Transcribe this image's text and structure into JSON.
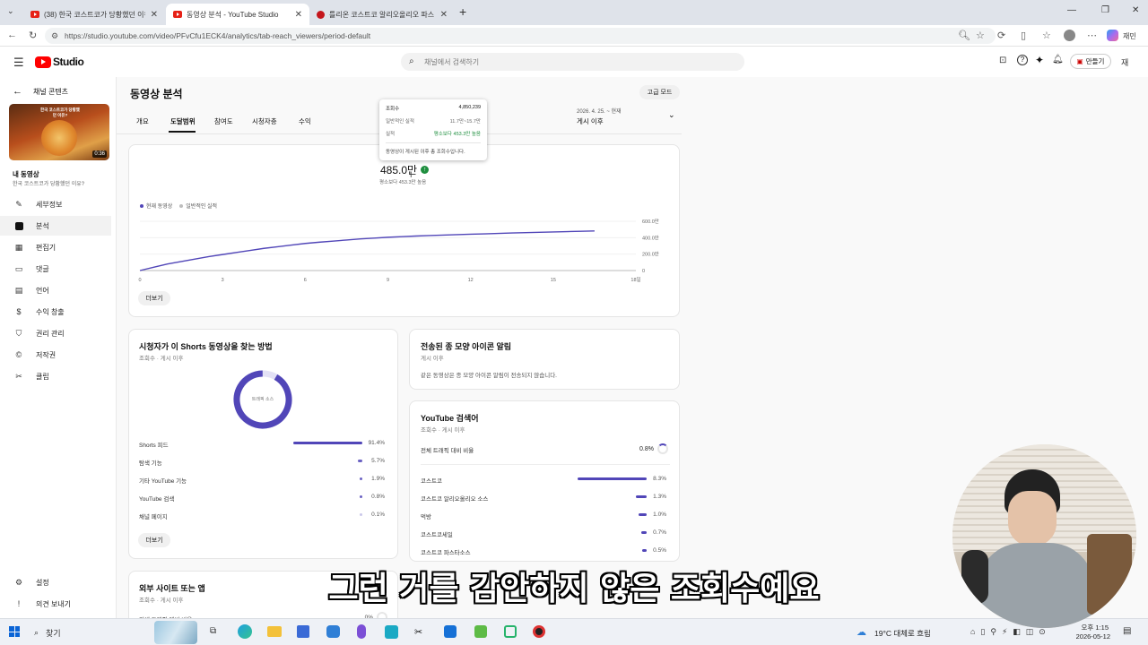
{
  "browser": {
    "tabs": [
      {
        "label": "(38) 한국 코스트코가 당황했던 이유"
      },
      {
        "label": "동영상 분석 - YouTube Studio"
      },
      {
        "label": "틀리온 코스트코 알리오올리오 파스"
      }
    ],
    "url": "https://studio.youtube.com/video/PFvCfu1ECK4/analytics/tab-reach_viewers/period-default",
    "profile_label": "재민"
  },
  "studio": {
    "logo_text": "Studio",
    "search_placeholder": "채널에서 검색하기",
    "create_label": "만들기",
    "avatar_label": "재"
  },
  "sidebar": {
    "back_label": "채널 콘텐츠",
    "thumb_duration": "0:36",
    "thumb_caption": "한국 코스트코가 당황했던 이유?",
    "my_video_label": "내 동영상",
    "video_title": "한국 코스트코가 당황했던 이유?",
    "items": [
      {
        "label": "세부정보",
        "icon": "pencil-icon"
      },
      {
        "label": "분석",
        "icon": "analytics-icon"
      },
      {
        "label": "편집기",
        "icon": "editor-icon"
      },
      {
        "label": "댓글",
        "icon": "comments-icon"
      },
      {
        "label": "언어",
        "icon": "language-icon"
      },
      {
        "label": "수익 창출",
        "icon": "dollar-icon"
      },
      {
        "label": "권리 관리",
        "icon": "shield-icon"
      },
      {
        "label": "저작권",
        "icon": "copyright-icon"
      },
      {
        "label": "클립",
        "icon": "scissors-icon"
      }
    ],
    "settings_label": "설정",
    "feedback_label": "의견 보내기"
  },
  "page": {
    "title": "동영상 분석",
    "advanced_mode": "고급 모드",
    "tabs": [
      "개요",
      "도달범위",
      "참여도",
      "시청자층",
      "수익"
    ],
    "date_range": "2026. 4. 25. ~ 현재",
    "date_label": "게시 이후"
  },
  "tooltip": {
    "rows": [
      {
        "label": "조회수",
        "value": "4,850,239"
      },
      {
        "label": "일반적인 실적",
        "value": "11.7만~15.7만"
      },
      {
        "label": "실적",
        "value": "평소보다 453.3만 높음"
      }
    ],
    "note": "동영상이 게시된 이후 총 조회수입니다."
  },
  "views_card": {
    "metric_value": "485.0만",
    "metric_sub": "평소보다 453.3만 높음",
    "legend_current": "현재 동영상",
    "legend_typical": "일반적인 실적",
    "more_button": "더보기"
  },
  "chart_data": {
    "type": "line",
    "x": [
      0,
      0.5,
      1,
      1.5,
      2,
      2.5,
      3,
      3.5,
      4,
      4.5,
      5,
      5.5,
      6,
      6.5,
      7,
      7.5,
      8,
      8.5,
      9,
      9.5,
      10,
      10.5,
      11,
      11.5,
      12,
      12.5,
      13,
      13.5,
      14,
      14.5,
      15,
      15.5,
      16,
      16.5
    ],
    "series": [
      {
        "name": "현재 동영상",
        "values": [
          0,
          40,
          80,
          110,
          140,
          170,
          195,
          220,
          245,
          270,
          290,
          310,
          330,
          345,
          358,
          372,
          385,
          395,
          405,
          413,
          420,
          426,
          432,
          437,
          442,
          447,
          452,
          457,
          462,
          466,
          470,
          474,
          478,
          482
        ]
      }
    ],
    "x_ticks": [
      "0",
      "3",
      "6",
      "9",
      "12",
      "15",
      "18일"
    ],
    "y_ticks": [
      "0",
      "200.0만",
      "400.0만",
      "600.0만"
    ],
    "xlim": [
      0,
      18
    ],
    "ylim": [
      0,
      600
    ]
  },
  "traffic_card": {
    "title": "시청자가 이 Shorts 동영상을 찾는 방법",
    "subtitle": "조회수 · 게시 이후",
    "donut_label": "트래픽 소스",
    "donut_share": 0.914,
    "rows": [
      {
        "label": "Shorts 피드",
        "value": "91.4%",
        "pct": 91.4
      },
      {
        "label": "탐색 기능",
        "value": "5.7%",
        "pct": 5.7
      },
      {
        "label": "기타 YouTube 기능",
        "value": "1.9%",
        "pct": 1.9
      },
      {
        "label": "YouTube 검색",
        "value": "0.8%",
        "pct": 0.8
      },
      {
        "label": "채널 페이지",
        "value": "0.1%",
        "pct": 0.1
      }
    ],
    "more_button": "더보기"
  },
  "bell_card": {
    "title": "전송된 종 모양 아이콘 알림",
    "subtitle": "게시 이후",
    "body": "같은 동영상은 종 모양 아이콘 알림이 전송되지 않습니다."
  },
  "search_card": {
    "title": "YouTube 검색어",
    "subtitle": "조회수 · 게시 이후",
    "total_label": "전체 트래픽 대비 비율",
    "total_value": "0.8%",
    "rows": [
      {
        "label": "코스트코",
        "value": "8.3%",
        "pct": 8.3
      },
      {
        "label": "코스트코 알리오올리오 소스",
        "value": "1.3%",
        "pct": 1.3
      },
      {
        "label": "먹방",
        "value": "1.0%",
        "pct": 1.0
      },
      {
        "label": "코스트코세일",
        "value": "0.7%",
        "pct": 0.7
      },
      {
        "label": "코스트코 파스타소스",
        "value": "0.5%",
        "pct": 0.5
      }
    ]
  },
  "external_card": {
    "title": "외부 사이트 또는 앱",
    "subtitle": "조회수 · 게시 이후",
    "total_label": "전체 트래픽 대비 비율",
    "total_value": "0%"
  },
  "taskbar": {
    "search_label": "찾기",
    "weather": "19°C 대체로 흐림",
    "time": "오후 1:15",
    "date": "2026-05-12"
  },
  "subtitle": "그런 거를 감안하지 않은 조회수예요",
  "colors": {
    "accent": "#5146b8",
    "youtube_red": "#ff0000",
    "success": "#1e8e3e"
  }
}
